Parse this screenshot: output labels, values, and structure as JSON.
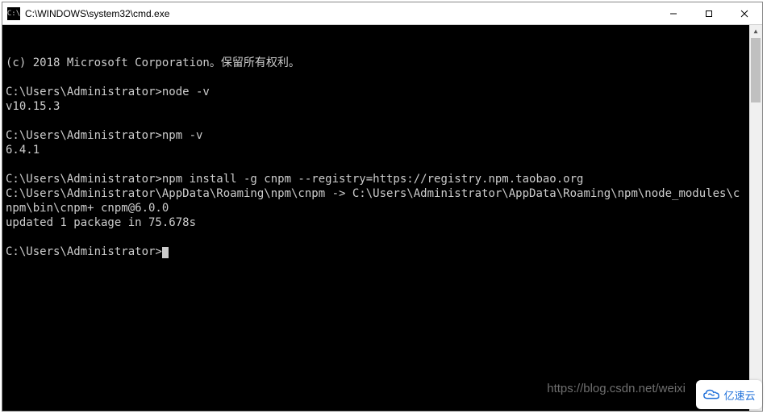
{
  "window": {
    "title": "C:\\WINDOWS\\system32\\cmd.exe",
    "icon_text": "C:\\"
  },
  "terminal": {
    "lines": [
      "(c) 2018 Microsoft Corporation。保留所有权利。",
      "",
      "C:\\Users\\Administrator>node -v",
      "v10.15.3",
      "",
      "C:\\Users\\Administrator>npm -v",
      "6.4.1",
      "",
      "C:\\Users\\Administrator>npm install -g cnpm --registry=https://registry.npm.taobao.org",
      "C:\\Users\\Administrator\\AppData\\Roaming\\npm\\cnpm -> C:\\Users\\Administrator\\AppData\\Roaming\\npm\\node_modules\\cnpm\\bin\\cnpm+ cnpm@6.0.0",
      "updated 1 package in 75.678s",
      "",
      "C:\\Users\\Administrator>"
    ],
    "cursor_on_last": true
  },
  "watermark": {
    "text": "https://blog.csdn.net/weixi"
  },
  "badge": {
    "text": "亿速云"
  }
}
